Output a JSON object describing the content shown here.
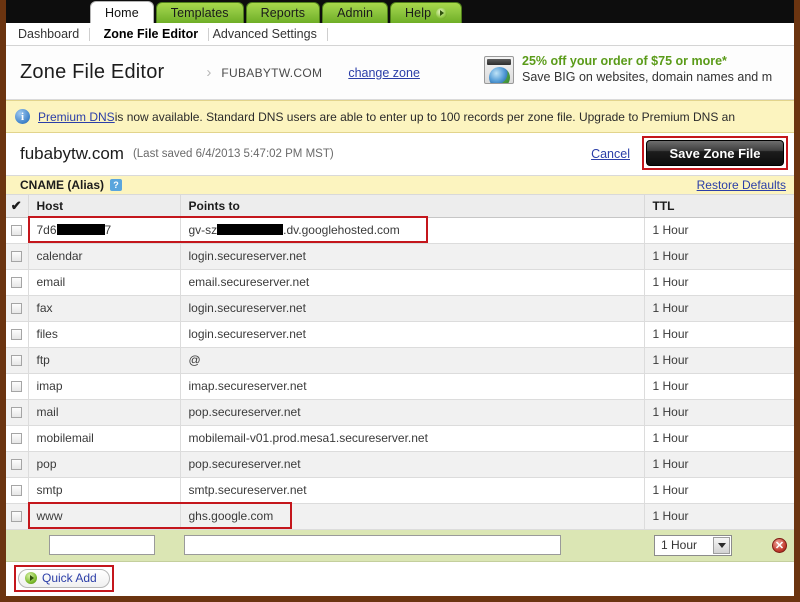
{
  "tabs": [
    {
      "label": "Home",
      "active": true,
      "arrow": false
    },
    {
      "label": "Templates",
      "active": false,
      "arrow": false
    },
    {
      "label": "Reports",
      "active": false,
      "arrow": false
    },
    {
      "label": "Admin",
      "active": false,
      "arrow": false
    },
    {
      "label": "Help",
      "active": false,
      "arrow": true
    }
  ],
  "subnav": [
    {
      "label": "Dashboard",
      "current": false
    },
    {
      "label": "Zone File Editor",
      "current": true
    },
    {
      "label": "Advanced Settings",
      "current": false
    }
  ],
  "header": {
    "page_title": "Zone File Editor",
    "chevron": "›",
    "zone_name": "FUBABYTW.COM",
    "change_zone_label": "change zone",
    "promo_line1": "25% off your order of $75 or more*",
    "promo_line2": "Save BIG on websites, domain names and m"
  },
  "notice": {
    "icon_glyph": "i",
    "link_label": "Premium DNS",
    "text": " is now available. Standard DNS users are able to enter up to 100 records per zone file. Upgrade to Premium DNS an"
  },
  "zonebar": {
    "domain": "fubabytw.com",
    "last_saved": "(Last saved 6/4/2013 5:47:02 PM MST)",
    "cancel_label": "Cancel",
    "save_label": "Save Zone File"
  },
  "section": {
    "title": "CNAME (Alias)",
    "help_badge": "?",
    "restore_label": "Restore Defaults"
  },
  "table": {
    "columns": [
      "✔",
      "Host",
      "Points to",
      "TTL"
    ],
    "rows": [
      {
        "host": "7d6",
        "host_redact": true,
        "host_suffix": "7",
        "points_to_prefix": "gv-sz",
        "points_to_redact": true,
        "points_to_suffix": ".dv.googlehosted.com",
        "ttl": "1 Hour",
        "highlight": true
      },
      {
        "host": "calendar",
        "points_to": "login.secureserver.net",
        "ttl": "1 Hour",
        "highlight": false
      },
      {
        "host": "email",
        "points_to": "email.secureserver.net",
        "ttl": "1 Hour",
        "highlight": false
      },
      {
        "host": "fax",
        "points_to": "login.secureserver.net",
        "ttl": "1 Hour",
        "highlight": false
      },
      {
        "host": "files",
        "points_to": "login.secureserver.net",
        "ttl": "1 Hour",
        "highlight": false
      },
      {
        "host": "ftp",
        "points_to": "@",
        "ttl": "1 Hour",
        "highlight": false
      },
      {
        "host": "imap",
        "points_to": "imap.secureserver.net",
        "ttl": "1 Hour",
        "highlight": false
      },
      {
        "host": "mail",
        "points_to": "pop.secureserver.net",
        "ttl": "1 Hour",
        "highlight": false
      },
      {
        "host": "mobilemail",
        "points_to": "mobilemail-v01.prod.mesa1.secureserver.net",
        "ttl": "1 Hour",
        "highlight": false
      },
      {
        "host": "pop",
        "points_to": "pop.secureserver.net",
        "ttl": "1 Hour",
        "highlight": false
      },
      {
        "host": "smtp",
        "points_to": "smtp.secureserver.net",
        "ttl": "1 Hour",
        "highlight": false
      },
      {
        "host": "www",
        "points_to": "ghs.google.com",
        "ttl": "1 Hour",
        "highlight": true
      }
    ]
  },
  "add_row": {
    "host_value": "",
    "host_placeholder": "",
    "points_to_value": "",
    "points_to_placeholder": "",
    "ttl_selected": "1 Hour",
    "ttl_options": [
      "1 Hour"
    ],
    "delete_glyph": "✕"
  },
  "footer": {
    "quick_add_label": "Quick Add"
  },
  "colors": {
    "highlight_red": "#c4161c",
    "tab_green": "#8ec63f",
    "notice_yellow": "#fcf4bf",
    "add_row_green": "#dbe6b4",
    "link_blue": "#2b3ea8",
    "promo_green": "#5a9b19",
    "frame_brown": "#6b3410"
  }
}
